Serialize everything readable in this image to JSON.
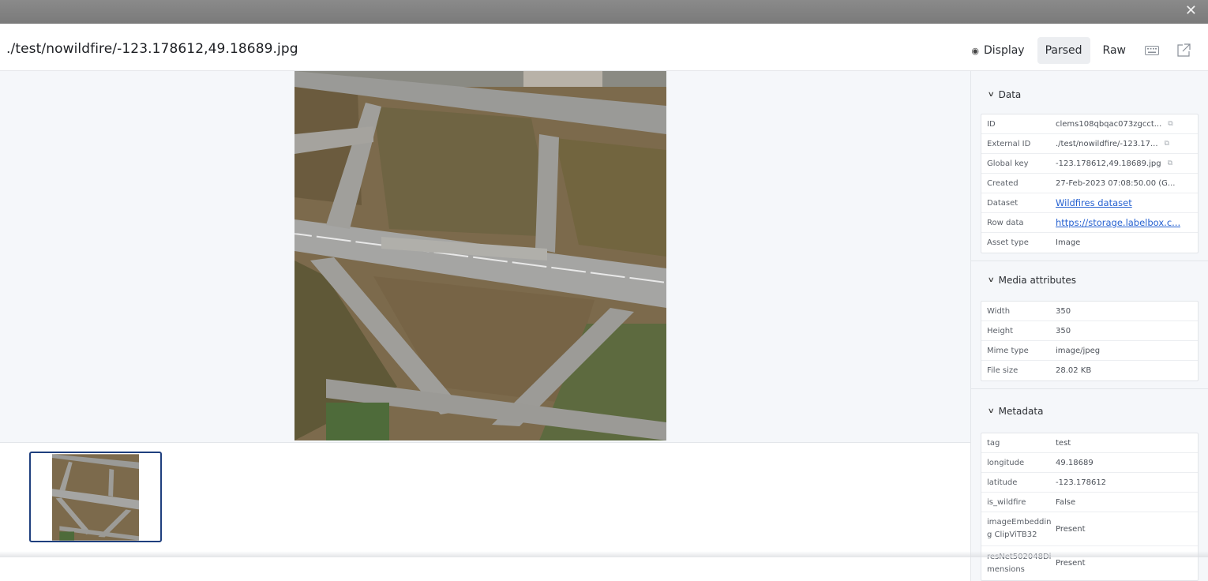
{
  "window": {
    "close_glyph": "✕"
  },
  "header": {
    "title": "./test/nowildfire/-123.178612,49.18689.jpg",
    "tabs": [
      {
        "label": "Display",
        "icon": "eye-icon",
        "active": false
      },
      {
        "label": "Parsed",
        "active": true
      },
      {
        "label": "Raw",
        "active": false
      }
    ],
    "icons": [
      "keyboard-icon",
      "open-external-icon"
    ]
  },
  "panel": {
    "data": {
      "title": "Data",
      "rows": [
        {
          "key": "ID",
          "value": "clems108qbqac073zgcct...",
          "copy": true
        },
        {
          "key": "External ID",
          "value": "./test/nowildfire/-123.17...",
          "copy": true
        },
        {
          "key": "Global key",
          "value": "-123.178612,49.18689.jpg",
          "copy": true
        },
        {
          "key": "Created",
          "value": "27-Feb-2023 07:08:50.00 (G..."
        },
        {
          "key": "Dataset",
          "value": "Wildfires dataset",
          "link": true
        },
        {
          "key": "Row data",
          "value": "https://storage.labelbox.c...",
          "link": true
        },
        {
          "key": "Asset type",
          "value": "Image"
        }
      ]
    },
    "media": {
      "title": "Media attributes",
      "rows": [
        {
          "key": "Width",
          "value": "350"
        },
        {
          "key": "Height",
          "value": "350"
        },
        {
          "key": "Mime type",
          "value": "image/jpeg"
        },
        {
          "key": "File size",
          "value": "28.02 KB"
        }
      ]
    },
    "metadata": {
      "title": "Metadata",
      "rows": [
        {
          "key": "tag",
          "value": "test"
        },
        {
          "key": "longitude",
          "value": "49.18689"
        },
        {
          "key": "latitude",
          "value": "-123.178612"
        },
        {
          "key": "is_wildfire",
          "value": "False"
        },
        {
          "key": "imageEmbedding ClipViTB32",
          "value": "Present",
          "tall": true
        },
        {
          "key": "resNet502048Dimensions",
          "value": "Present",
          "tall": true
        }
      ]
    }
  },
  "colors": {
    "accent": "#1f3f7e",
    "link": "#2762d1",
    "panel_bg": "#f5f7fa"
  }
}
